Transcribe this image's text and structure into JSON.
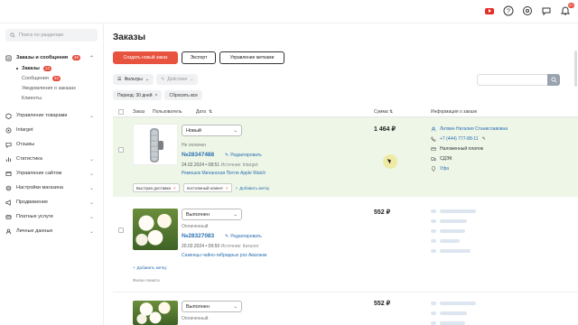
{
  "topbar": {
    "icons": [
      "youtube-icon",
      "help-icon",
      "settings-icon",
      "chat-icon",
      "bell-icon"
    ],
    "notification_count": "22"
  },
  "sidebar": {
    "search_placeholder": "Поиск по разделам",
    "orders_section": {
      "label": "Заказы и сообщения",
      "badge": "46"
    },
    "sub_items": [
      {
        "label": "Заказы",
        "badge": "13",
        "active": true
      },
      {
        "label": "Сообщения",
        "badge": "33"
      },
      {
        "label": "Уведомления о заказах"
      },
      {
        "label": "Клиенты"
      }
    ],
    "items": [
      {
        "label": "Управление товарами",
        "icon": "box-icon",
        "chevron": true
      },
      {
        "label": "Intarget",
        "icon": "target-icon",
        "chevron": false
      },
      {
        "label": "Отзывы",
        "icon": "review-icon",
        "chevron": false
      },
      {
        "label": "Статистика",
        "icon": "stats-icon",
        "chevron": true
      },
      {
        "label": "Управление сайтом",
        "icon": "site-icon",
        "chevron": true
      },
      {
        "label": "Настройки магазина",
        "icon": "store-settings-icon",
        "chevron": true
      },
      {
        "label": "Продвижение",
        "icon": "promo-icon",
        "chevron": true
      },
      {
        "label": "Платные услуги",
        "icon": "paid-icon",
        "chevron": true
      },
      {
        "label": "Личные данные",
        "icon": "user-icon",
        "chevron": true
      }
    ]
  },
  "main": {
    "title": "Заказы",
    "buttons": {
      "create": "Создать новый заказ",
      "export": "Экспорт",
      "tags": "Управление метками"
    },
    "filters": {
      "filters_label": "Фильтры",
      "actions_label": "Действия"
    },
    "chips": {
      "period": "Период: 30 дней",
      "reset": "Сбросить все"
    },
    "table_headers": {
      "order": "Заказ",
      "user": "Пользователь",
      "date": "Дата",
      "sum": "Сумма",
      "info": "Информация о заказе"
    },
    "orders": [
      {
        "status": "Новый",
        "payment": "Не оплачен",
        "number": "№28347488",
        "edit": "Редактировать",
        "datetime": "24.02.2024 • 08:51",
        "source": "Источник: Intarget",
        "product": "Ремешок Миланская Петля Apple Watch",
        "sum": "1 464 ₽",
        "customer": {
          "name": "Литвин Наталия Станиславовна",
          "phone": "+7 (444) 777-88-11",
          "payment_method": "Наложенный платеж",
          "delivery": "СДЭК",
          "city": "Уфа"
        },
        "tags": [
          "Быстрая доставка",
          "постоянный клиент"
        ],
        "add_tag": "Добавить метку"
      },
      {
        "status": "Выполнен",
        "payment": "Оплаченный",
        "number": "№28327083",
        "edit": "Редактировать",
        "datetime": "20.02.2024 • 09:59",
        "source": "Источник: Каталог",
        "product": "Саженцы чайно-гибридных роз Аваланж",
        "sum": "552 ₽",
        "add_tag": "Добавить метку",
        "author": "Филин Никита"
      },
      {
        "status": "Выполнен",
        "payment": "Оплаченный",
        "sum": "552 ₽"
      }
    ]
  },
  "colors": {
    "accent": "#e8533f",
    "link": "#2a6fb0",
    "highlight_row": "#eef6e8"
  }
}
